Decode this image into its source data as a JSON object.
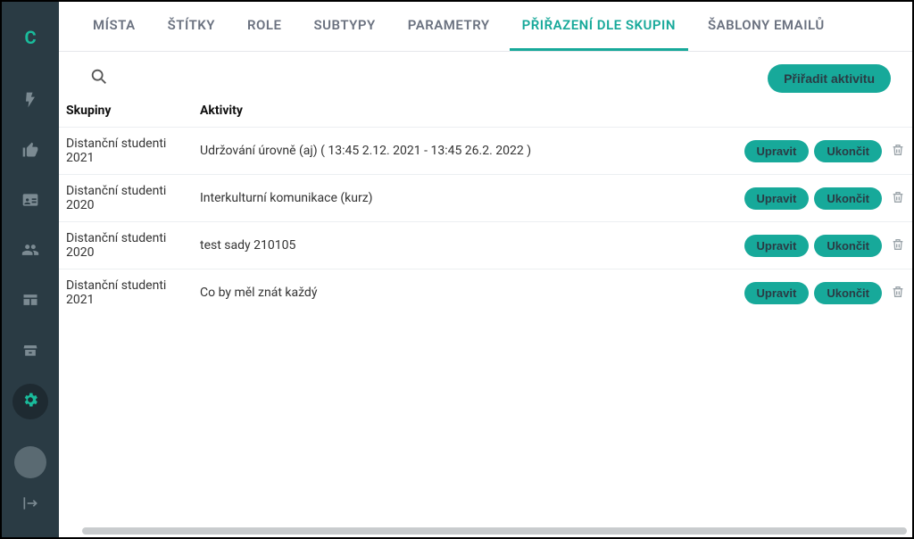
{
  "brand": {
    "logo_letter": "C"
  },
  "sidebar": {
    "items": [
      {
        "name": "bolt-icon"
      },
      {
        "name": "thumbs-up-icon"
      },
      {
        "name": "id-card-icon"
      },
      {
        "name": "users-icon"
      },
      {
        "name": "table-icon"
      },
      {
        "name": "archive-icon"
      }
    ],
    "settings": {
      "name": "gear-icon",
      "active": true
    }
  },
  "tabs": [
    {
      "label": "Místa",
      "active": false
    },
    {
      "label": "Štítky",
      "active": false
    },
    {
      "label": "Role",
      "active": false
    },
    {
      "label": "Subtypy",
      "active": false
    },
    {
      "label": "Parametry",
      "active": false
    },
    {
      "label": "Přiřazení dle skupin",
      "active": true
    },
    {
      "label": "Šablony emailů",
      "active": false
    }
  ],
  "toolbar": {
    "assign_label": "Přiřadit aktivitu"
  },
  "table": {
    "headers": {
      "group": "Skupiny",
      "activity": "Aktivity"
    },
    "edit_label": "Upravit",
    "end_label": "Ukončit",
    "rows": [
      {
        "group": "Distanční studenti 2021",
        "activity": "Udržování úrovně (aj)   ( 13:45 2.12. 2021 - 13:45 26.2. 2022 )"
      },
      {
        "group": "Distanční studenti 2020",
        "activity": "Interkulturní komunikace (kurz)"
      },
      {
        "group": "Distanční studenti 2020",
        "activity": "test sady 210105"
      },
      {
        "group": "Distanční studenti 2021",
        "activity": "Co by měl znát každý"
      }
    ]
  },
  "colors": {
    "accent": "#17a99a",
    "sidebar_bg": "#2a3b44"
  }
}
